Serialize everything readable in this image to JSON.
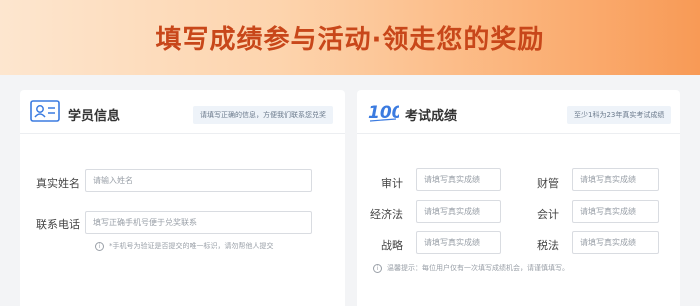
{
  "banner": {
    "title": "填写成绩参与活动·领走您的奖励"
  },
  "student": {
    "title": "学员信息",
    "tip": "请填写正确的信息，方便我们联系您兑奖",
    "name_label": "真实姓名",
    "name_placeholder": "请输入姓名",
    "phone_label": "联系电话",
    "phone_placeholder": "填写正确手机号便于兑奖联系",
    "phone_note": "*手机号为验证是否提交的唯一标识，请勿帮他人提交"
  },
  "scores": {
    "title": "考试成绩",
    "tip": "至少1科为23年真实考试成绩",
    "subjects": [
      {
        "label": "审计",
        "placeholder": "请填写真实成绩"
      },
      {
        "label": "财管",
        "placeholder": "请填写真实成绩"
      },
      {
        "label": "经济法",
        "placeholder": "请填写真实成绩"
      },
      {
        "label": "会计",
        "placeholder": "请填写真实成绩"
      },
      {
        "label": "战略",
        "placeholder": "请填写真实成绩"
      },
      {
        "label": "税法",
        "placeholder": "请填写真实成绩"
      }
    ],
    "note": "温馨提示：每位用户仅有一次填写成绩机会，请谨慎填写。"
  },
  "colors": {
    "accent": "#c8471a",
    "icon_blue": "#3b7be0"
  },
  "icons": {
    "student": "id-card-icon",
    "scores": "score-100-icon",
    "info": "info-icon"
  }
}
